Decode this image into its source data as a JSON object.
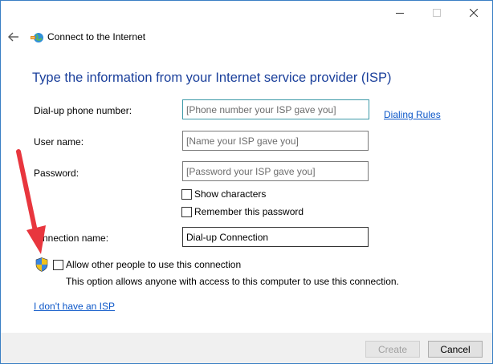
{
  "window": {
    "title": "Connect to the Internet"
  },
  "heading": "Type the information from your Internet service provider (ISP)",
  "form": {
    "phone_label": "Dial-up phone number:",
    "phone_placeholder": "[Phone number your ISP gave you]",
    "dialing_rules_link": "Dialing Rules",
    "username_label": "User name:",
    "username_placeholder": "[Name your ISP gave you]",
    "password_label": "Password:",
    "password_placeholder": "[Password your ISP gave you]",
    "show_characters_label": "Show characters",
    "show_characters_checked": false,
    "remember_password_label": "Remember this password",
    "remember_password_checked": false,
    "connection_name_label": "nnection name:",
    "connection_name_value": "Dial-up Connection",
    "allow_others_label": "Allow other people to use this connection",
    "allow_others_checked": false,
    "allow_others_note": "This option allows anyone with access to this computer to use this connection."
  },
  "no_isp_link": "I don't have an ISP",
  "footer": {
    "create_label": "Create",
    "cancel_label": "Cancel"
  },
  "colors": {
    "heading": "#1a3f9b",
    "link": "#0b56c8",
    "annotation_arrow": "#e8363e",
    "window_border": "#3a7fc4"
  }
}
